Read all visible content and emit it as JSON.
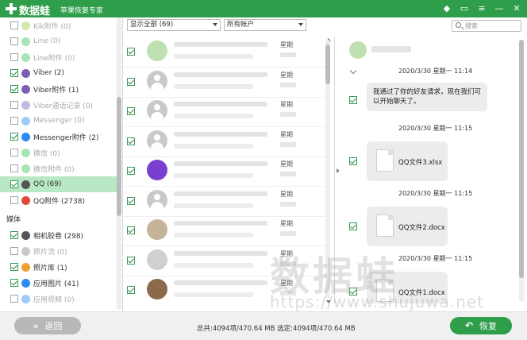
{
  "app": {
    "title": "数据蛙",
    "subtitle": "苹果恢复专家"
  },
  "sidebar": {
    "items": [
      {
        "label": "Kik附件 (0)",
        "checked": false,
        "dim": true,
        "color": "#9cd14a"
      },
      {
        "label": "Line (0)",
        "checked": false,
        "dim": true,
        "color": "#3fc35a"
      },
      {
        "label": "Line附件 (0)",
        "checked": false,
        "dim": true,
        "color": "#3fc35a"
      },
      {
        "label": "Viber (2)",
        "checked": true,
        "dim": false,
        "color": "#7b5fb6"
      },
      {
        "label": "Viber附件 (1)",
        "checked": true,
        "dim": false,
        "color": "#7b5fb6"
      },
      {
        "label": "Viber通话记录 (0)",
        "checked": false,
        "dim": true,
        "color": "#7b5fb6"
      },
      {
        "label": "Messenger (0)",
        "checked": false,
        "dim": true,
        "color": "#2d8cf0"
      },
      {
        "label": "Messenger附件 (2)",
        "checked": true,
        "dim": false,
        "color": "#2d8cf0"
      },
      {
        "label": "微信 (0)",
        "checked": false,
        "dim": true,
        "color": "#3fc35a"
      },
      {
        "label": "微信附件 (0)",
        "checked": false,
        "dim": true,
        "color": "#3fc35a"
      },
      {
        "label": "QQ (69)",
        "checked": true,
        "dim": false,
        "color": "#555555",
        "selected": true
      },
      {
        "label": "QQ附件 (2738)",
        "checked": false,
        "dim": false,
        "color": "#e04a3a"
      }
    ],
    "section_media": "媒体",
    "media_items": [
      {
        "label": "相机胶卷 (298)",
        "checked": true,
        "dim": false,
        "color": "#555555"
      },
      {
        "label": "照片流 (0)",
        "checked": false,
        "dim": true,
        "color": "#888888"
      },
      {
        "label": "照片库 (1)",
        "checked": true,
        "dim": false,
        "color": "#f0a030"
      },
      {
        "label": "应用图片 (41)",
        "checked": true,
        "dim": false,
        "color": "#2d8cf0"
      },
      {
        "label": "应用视频 (0)",
        "checked": false,
        "dim": true,
        "color": "#2d8cf0"
      }
    ]
  },
  "filters": {
    "show": "显示全部 (69)",
    "account": "所有帐户"
  },
  "list": {
    "rows": [
      {
        "checked": true,
        "week": "星期",
        "avatar": "frog"
      },
      {
        "checked": true,
        "week": "星期",
        "avatar": "person"
      },
      {
        "checked": true,
        "week": "星期",
        "avatar": "person"
      },
      {
        "checked": true,
        "week": "星期",
        "avatar": "person"
      },
      {
        "checked": true,
        "week": "星期",
        "avatar": "purple"
      },
      {
        "checked": true,
        "week": "星期",
        "avatar": "person"
      },
      {
        "checked": true,
        "week": "星期",
        "avatar": "photo1"
      },
      {
        "checked": true,
        "week": "星期",
        "avatar": "photo2"
      },
      {
        "checked": true,
        "week": "星期",
        "avatar": "photo3"
      }
    ]
  },
  "search": {
    "placeholder": "搜索"
  },
  "chat": {
    "messages": [
      {
        "time": "2020/3/30 星期一 11:14",
        "type": "text",
        "text_line1": "我通过了你的好友请求，现在我们可",
        "text_line2": "以开始聊天了。"
      },
      {
        "time": "2020/3/30 星期一 11:15",
        "type": "file",
        "filename": "QQ文件3.xlsx"
      },
      {
        "time": "2020/3/30 星期一 11:15",
        "type": "file",
        "filename": "QQ文件2.docx"
      },
      {
        "time": "2020/3/30 星期一 11:15",
        "type": "file",
        "filename": "QQ文件1.docx"
      }
    ]
  },
  "watermark": {
    "brand": "数据蛙",
    "url": "https://www.shujuwa.net"
  },
  "bottom": {
    "back_label": "返回",
    "totals": "总共:4094项/470.64 MB 选定:4094项/470.64 MB",
    "recover_label": "恢复"
  },
  "colors": {
    "brand_green": "#2e9e4a",
    "selected_row": "#b9e8c5"
  }
}
